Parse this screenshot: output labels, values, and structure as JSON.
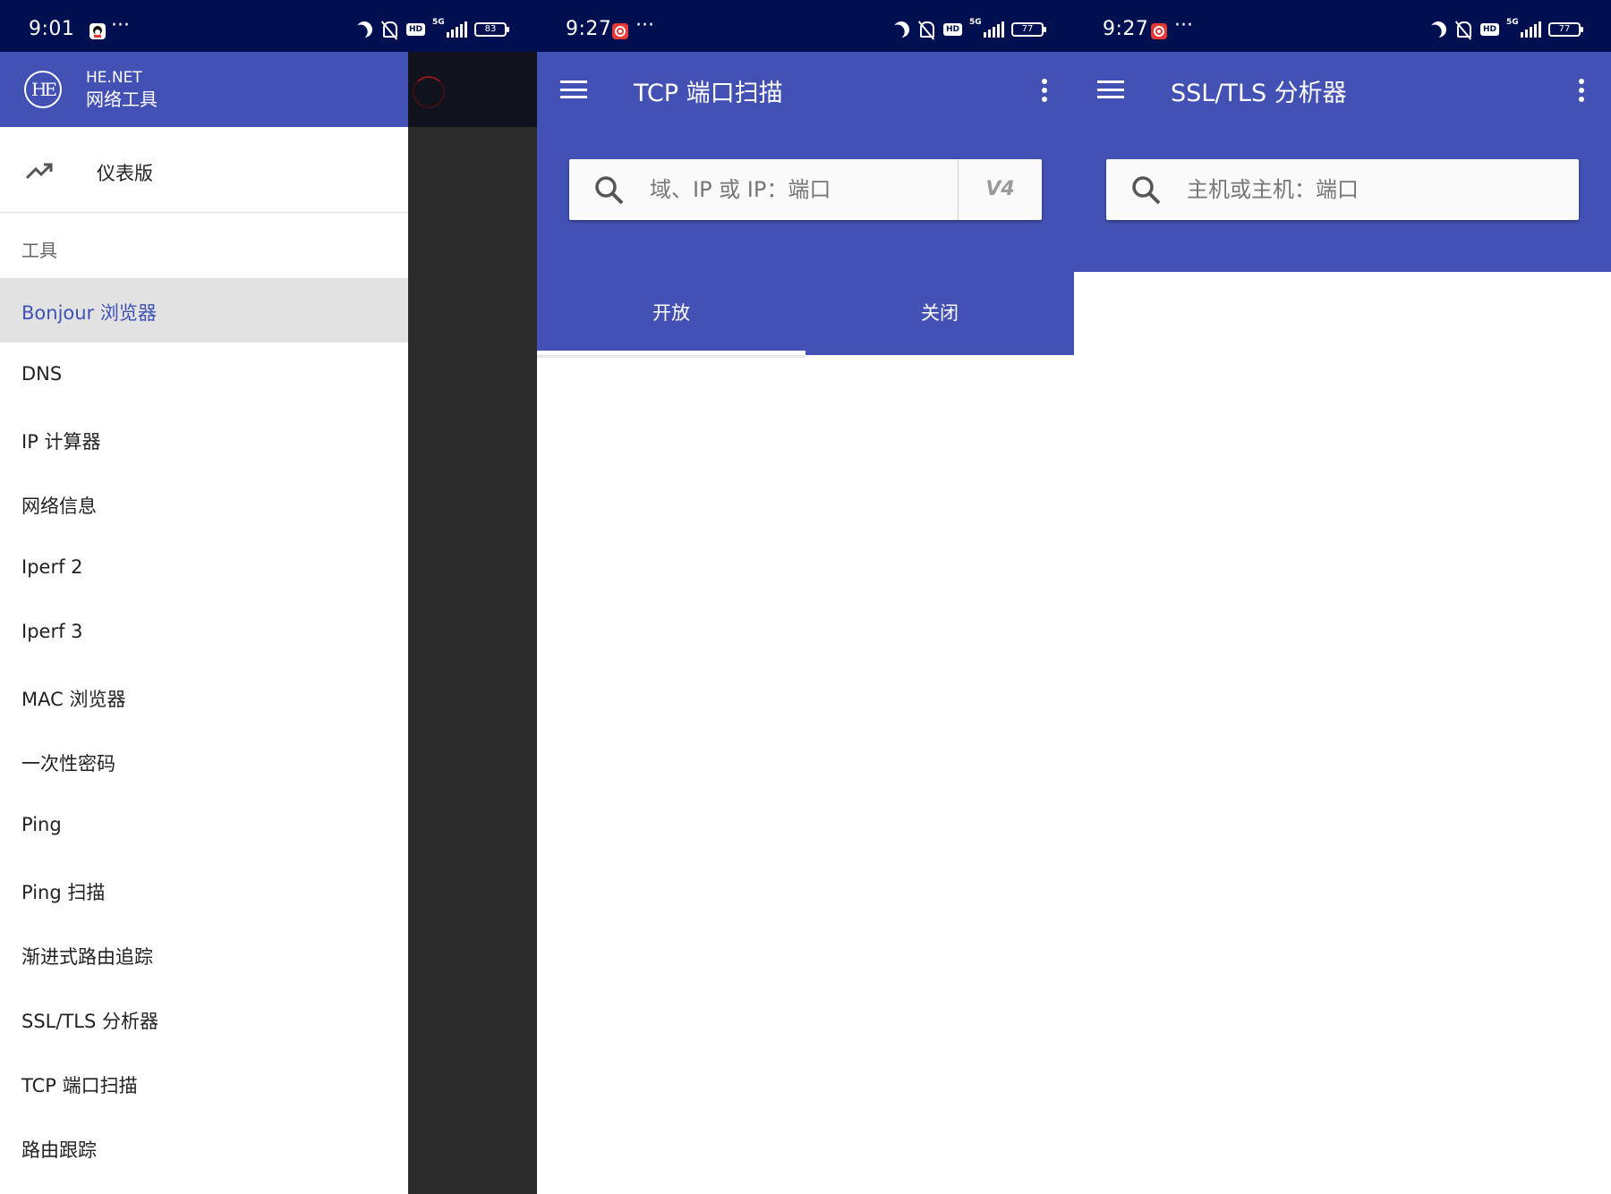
{
  "panels": [
    {
      "status": {
        "time": "9:01",
        "dots": "···",
        "battery": "83",
        "network": "5G"
      },
      "drawer": {
        "brand_line1": "HE.NET",
        "brand_line2": "网络工具",
        "logo_text": "HE",
        "dashboard": "仪表版",
        "section": "工具",
        "items": [
          "Bonjour 浏览器",
          "DNS",
          "IP 计算器",
          "网络信息",
          "Iperf 2",
          "Iperf 3",
          "MAC 浏览器",
          "一次性密码",
          "Ping",
          "Ping 扫描",
          "渐进式路由追踪",
          "SSL/TLS 分析器",
          "TCP 端口扫描",
          "路由跟踪"
        ],
        "active_index": 0
      }
    },
    {
      "status": {
        "time": "9:27",
        "dots": "···",
        "battery": "77",
        "network": "5G"
      },
      "title": "TCP 端口扫描",
      "search": {
        "placeholder": "域、IP 或 IP：端口",
        "toggle": "V4"
      },
      "tabs": [
        "开放",
        "关闭"
      ]
    },
    {
      "status": {
        "time": "9:27",
        "dots": "···",
        "battery": "77",
        "network": "5G"
      },
      "title": "SSL/TLS 分析器",
      "search": {
        "placeholder": "主机或主机：端口"
      }
    }
  ],
  "colors": {
    "primary": "#4451b4",
    "statusbar": "#000f4f",
    "active_text": "#3f51b5",
    "active_bg": "#e2e2e2"
  }
}
